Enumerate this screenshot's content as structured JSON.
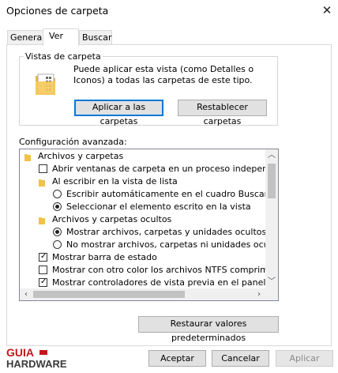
{
  "window": {
    "title": "Opciones de carpeta"
  },
  "tabs": [
    {
      "label": "General"
    },
    {
      "label": "Ver"
    },
    {
      "label": "Buscar"
    }
  ],
  "folder_views": {
    "title": "Vistas de carpeta",
    "description": "Puede aplicar esta vista (como Detalles o Iconos) a todas las carpetas de este tipo.",
    "apply_label": "Aplicar a las carpetas",
    "reset_label": "Restablecer carpetas"
  },
  "advanced": {
    "label": "Configuración avanzada:",
    "items": [
      {
        "kind": "folder",
        "label": "Archivos y carpetas",
        "level": 0
      },
      {
        "kind": "checkbox",
        "label": "Abrir ventanas de carpeta en un proceso independiente",
        "checked": false,
        "level": 1
      },
      {
        "kind": "folder",
        "label": "Al escribir en la vista de lista",
        "level": 1
      },
      {
        "kind": "radio",
        "label": "Escribir automáticamente en el cuadro Buscar",
        "checked": false,
        "level": 2
      },
      {
        "kind": "radio",
        "label": "Seleccionar el elemento escrito en la vista",
        "checked": true,
        "level": 2
      },
      {
        "kind": "folder",
        "label": "Archivos y carpetas ocultos",
        "level": 1
      },
      {
        "kind": "radio",
        "label": "Mostrar archivos, carpetas y unidades ocultos",
        "checked": true,
        "level": 2
      },
      {
        "kind": "radio",
        "label": "No mostrar archivos, carpetas ni unidades ocultos",
        "checked": false,
        "level": 2
      },
      {
        "kind": "checkbox",
        "label": "Mostrar barra de estado",
        "checked": true,
        "level": 1
      },
      {
        "kind": "checkbox",
        "label": "Mostrar con otro color los archivos NTFS comprimidos o c",
        "checked": false,
        "level": 1
      },
      {
        "kind": "checkbox",
        "label": "Mostrar controladores de vista previa en el panel de vista",
        "checked": true,
        "level": 1
      }
    ]
  },
  "restore_label": "Restaurar valores predeterminados",
  "footer": {
    "accept_label": "Aceptar",
    "cancel_label": "Cancelar",
    "apply_label": "Aplicar"
  },
  "watermark": {
    "line1": "GUIA",
    "line2": "HARDWARE"
  },
  "colors": {
    "focus_border": "#0078d7",
    "folder_yellow": "#f0c24a",
    "logo_red": "#c4161c"
  }
}
